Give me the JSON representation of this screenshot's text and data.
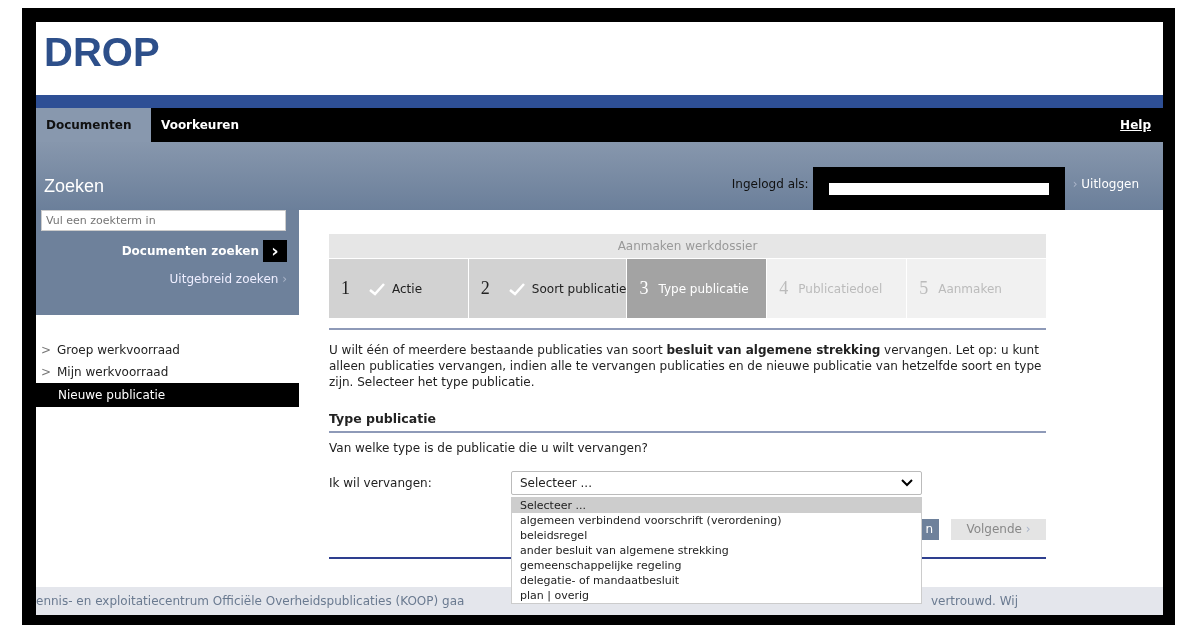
{
  "logo": "DROP",
  "nav": {
    "tabs": [
      {
        "label": "Documenten",
        "selected": true
      },
      {
        "label": "Voorkeuren",
        "selected": false
      }
    ],
    "help": "Help"
  },
  "search": {
    "title": "Zoeken",
    "placeholder": "Vul een zoekterm in",
    "submit": "Documenten zoeken",
    "submit_icon": "›",
    "advanced": "Uitgebreid zoeken",
    "advanced_icon": "›"
  },
  "user": {
    "label": "Ingelogd als:",
    "logout_icon": "›",
    "logout": "Uitloggen"
  },
  "sidebar": {
    "items": [
      {
        "icon": ">",
        "label": "Groep werkvoorraad",
        "selected": false
      },
      {
        "icon": ">",
        "label": "Mijn werkvoorraad",
        "selected": false
      },
      {
        "label": "Nieuwe publicatie",
        "selected": true
      }
    ]
  },
  "wizard": {
    "title": "Aanmaken werkdossier",
    "steps": [
      {
        "number": "1",
        "label": "Actie",
        "completed": true,
        "selected": false
      },
      {
        "number": "2",
        "label": "Soort publicatie",
        "completed": true,
        "selected": false
      },
      {
        "number": "3",
        "label": "Type publicatie",
        "completed": false,
        "selected": true
      },
      {
        "number": "4",
        "label": "Publicatiedoel",
        "completed": false,
        "selected": false
      },
      {
        "number": "5",
        "label": "Aanmaken",
        "completed": false,
        "selected": false
      }
    ]
  },
  "intro": "U wilt één of meerdere bestaande publicaties van soort **besluit van algemene strekking** vervangen. Let op: u kunt alleen publicaties vervangen, indien alle te vervangen publicaties en de nieuwe publicatie van hetzelfde soort en type zijn. Selecteer het type publicatie.",
  "section": {
    "heading": "Type publicatie",
    "question": "Van welke type is de publicatie die u wilt vervangen?",
    "field_label": "Ik wil vervangen:",
    "select_value": "Selecteer ...",
    "expanded": true,
    "options": [
      {
        "label": "Selecteer ...",
        "selected": true
      },
      {
        "label": "algemeen verbindend voorschrift (verordening)",
        "selected": false
      },
      {
        "label": "beleidsregel",
        "selected": false
      },
      {
        "label": "ander besluit van algemene strekking",
        "selected": false
      },
      {
        "label": "gemeenschappelijke regeling",
        "selected": false
      },
      {
        "label": "delegatie- of mandaatbesluit",
        "selected": false
      },
      {
        "label": "plan | overig",
        "selected": false
      }
    ]
  },
  "buttons": [
    {
      "label": "n",
      "disabled": false
    },
    {
      "label": "Volgende",
      "icon": "›",
      "disabled": true
    }
  ],
  "footer": {
    "left": "ennis- en exploitatiecentrum Officiële Overheidspublicaties (KOOP) gaa",
    "right": "vertrouwd. Wij"
  }
}
